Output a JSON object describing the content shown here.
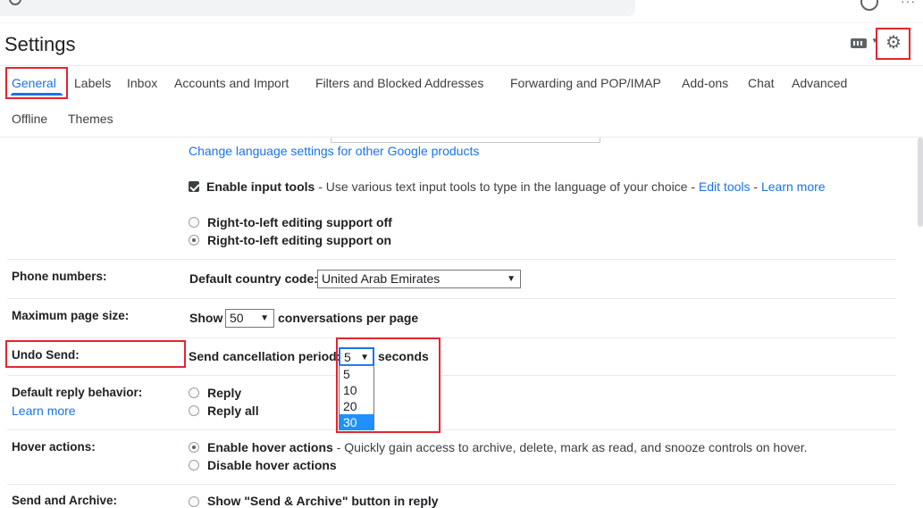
{
  "app": {
    "title": "Settings"
  },
  "tabs": [
    {
      "label": "General",
      "active": true
    },
    {
      "label": "Labels"
    },
    {
      "label": "Inbox"
    },
    {
      "label": "Accounts and Import"
    },
    {
      "label": "Filters and Blocked Addresses"
    },
    {
      "label": "Forwarding and POP/IMAP"
    },
    {
      "label": "Add-ons"
    },
    {
      "label": "Chat"
    },
    {
      "label": "Advanced"
    },
    {
      "label": "Offline"
    },
    {
      "label": "Themes"
    }
  ],
  "language": {
    "change_link": "Change language settings for other Google products",
    "input_tools_label": "Enable input tools",
    "input_tools_desc": " - Use various text input tools to type in the language of your choice - ",
    "edit_tools": "Edit tools",
    "sep": " - ",
    "learn_more": "Learn more",
    "rtl_off": "Right-to-left editing support off",
    "rtl_on": "Right-to-left editing support on"
  },
  "phone": {
    "label": "Phone numbers:",
    "country_label": "Default country code:",
    "country_value": "United Arab Emirates"
  },
  "page_size": {
    "label": "Maximum page size:",
    "show": "Show",
    "value": "50",
    "suffix": "conversations per page"
  },
  "undo_send": {
    "label": "Undo Send:",
    "period_label": "Send cancellation period:",
    "value": "5",
    "suffix": "seconds",
    "options": [
      "5",
      "10",
      "20",
      "30"
    ],
    "highlighted_option": "30"
  },
  "reply": {
    "label": "Default reply behavior:",
    "learn_more": "Learn more",
    "reply": "Reply",
    "reply_all": "Reply all"
  },
  "hover": {
    "label": "Hover actions:",
    "enable": "Enable hover actions",
    "enable_desc": " - Quickly gain access to archive, delete, mark as read, and snooze controls on hover.",
    "disable": "Disable hover actions"
  },
  "send_archive": {
    "label": "Send and Archive:",
    "show_button": "Show \"Send & Archive\" button in reply"
  },
  "colors": {
    "accent": "#1a73e8",
    "highlight_box": "#e3252f",
    "selected_option": "#1e90ff"
  }
}
